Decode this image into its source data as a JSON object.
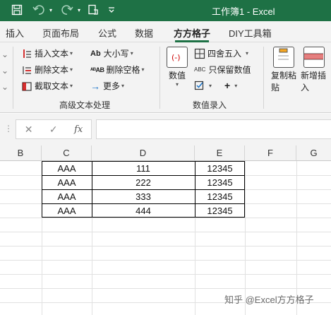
{
  "window": {
    "title": "工作簿1  -  Excel",
    "title_bar_color": "#1e7145"
  },
  "quick_access": {
    "icons": [
      "save-icon",
      "undo-icon",
      "redo-icon",
      "format-painter-icon",
      "customize-qat-icon"
    ]
  },
  "tabs": {
    "items": [
      {
        "label": "插入"
      },
      {
        "label": "页面布局"
      },
      {
        "label": "公式"
      },
      {
        "label": "数据"
      },
      {
        "label": "方方格子"
      },
      {
        "label": "DIY工具箱"
      }
    ],
    "active": "方方格子"
  },
  "ribbon": {
    "text_group": {
      "insert_text": "插入文本",
      "delete_text": "删除文本",
      "truncate_text": "截取文本",
      "case": "大小写",
      "delete_spaces": "删除空格",
      "more": "更多",
      "label": "高级文本处理"
    },
    "number_group": {
      "numeric": "数值",
      "round": "四舍五入",
      "keep_numbers": "只保留数值",
      "label": "数值录入"
    },
    "right_group": {
      "copy_paste": "复制粘贴",
      "add_insert": "新增插入"
    }
  },
  "formula_bar": {
    "cancel": "✕",
    "enter": "✓",
    "fx": "fx",
    "value": ""
  },
  "columns": [
    "B",
    "C",
    "D",
    "E",
    "F",
    "G"
  ],
  "table": {
    "rows": [
      [
        "AAA",
        "111",
        "12345"
      ],
      [
        "AAA",
        "222",
        "12345"
      ],
      [
        "AAA",
        "333",
        "12345"
      ],
      [
        "AAA",
        "444",
        "12345"
      ]
    ]
  },
  "watermark": "知乎 @Excel方方格子"
}
